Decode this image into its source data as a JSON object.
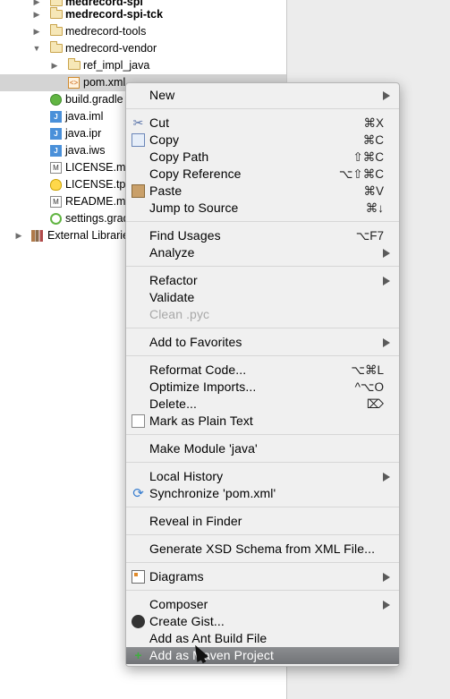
{
  "tree": {
    "items": [
      {
        "label": "medrecord-spi",
        "icon": "folder-icon",
        "expanded": false,
        "bold": true
      },
      {
        "label": "medrecord-spi-tck",
        "icon": "folder-icon",
        "expanded": false,
        "bold": true
      },
      {
        "label": "medrecord-tools",
        "icon": "folder-icon",
        "expanded": false,
        "bold": false
      },
      {
        "label": "medrecord-vendor",
        "icon": "folder-icon",
        "expanded": true,
        "bold": false
      },
      {
        "label": "ref_impl_java",
        "icon": "folder-icon",
        "expanded": false,
        "bold": false
      },
      {
        "label": "pom.xml",
        "icon": "maven-file-icon",
        "selected": true
      },
      {
        "label": "build.gradle",
        "icon": "gradle-file-icon"
      },
      {
        "label": "java.iml",
        "icon": "iml-file-icon"
      },
      {
        "label": "java.ipr",
        "icon": "ipr-file-icon"
      },
      {
        "label": "java.iws",
        "icon": "iws-file-icon"
      },
      {
        "label": "LICENSE.md",
        "icon": "markdown-file-icon"
      },
      {
        "label": "LICENSE.tpl",
        "icon": "template-file-icon"
      },
      {
        "label": "README.md",
        "icon": "markdown-file-icon"
      },
      {
        "label": "settings.gradle",
        "icon": "gradle-settings-icon"
      },
      {
        "label": "External Libraries",
        "icon": "library-icon",
        "expanded": false
      }
    ]
  },
  "menu": {
    "new": {
      "label": "New"
    },
    "cut": {
      "label": "Cut",
      "shortcut": "⌘X"
    },
    "copy": {
      "label": "Copy",
      "shortcut": "⌘C"
    },
    "copy_path": {
      "label": "Copy Path",
      "shortcut": "⇧⌘C"
    },
    "copy_reference": {
      "label": "Copy Reference",
      "shortcut": "⌥⇧⌘C"
    },
    "paste": {
      "label": "Paste",
      "shortcut": "⌘V"
    },
    "jump_to_source": {
      "label": "Jump to Source",
      "shortcut": "⌘↓"
    },
    "find_usages": {
      "label": "Find Usages",
      "shortcut": "⌥F7"
    },
    "analyze": {
      "label": "Analyze"
    },
    "refactor": {
      "label": "Refactor"
    },
    "validate": {
      "label": "Validate"
    },
    "clean_pyc": {
      "label": "Clean .pyc"
    },
    "add_to_favorites": {
      "label": "Add to Favorites"
    },
    "reformat_code": {
      "label": "Reformat Code...",
      "shortcut": "⌥⌘L"
    },
    "optimize_imports": {
      "label": "Optimize Imports...",
      "shortcut": "^⌥O"
    },
    "delete": {
      "label": "Delete...",
      "shortcut": "⌦"
    },
    "mark_plain_text": {
      "label": "Mark as Plain Text"
    },
    "make_module": {
      "label": "Make Module 'java'"
    },
    "local_history": {
      "label": "Local History"
    },
    "synchronize": {
      "label": "Synchronize 'pom.xml'"
    },
    "reveal_in_finder": {
      "label": "Reveal in Finder"
    },
    "generate_xsd": {
      "label": "Generate XSD Schema from XML File..."
    },
    "diagrams": {
      "label": "Diagrams"
    },
    "composer": {
      "label": "Composer"
    },
    "create_gist": {
      "label": "Create Gist..."
    },
    "add_ant_build": {
      "label": "Add as Ant Build File"
    },
    "add_maven_project": {
      "label": "Add as Maven Project"
    }
  },
  "colors": {
    "highlight": "#7d7f82",
    "menu_background": "#f0f0f0",
    "tree_background": "#ffffff",
    "selection": "#d4d4d4"
  }
}
